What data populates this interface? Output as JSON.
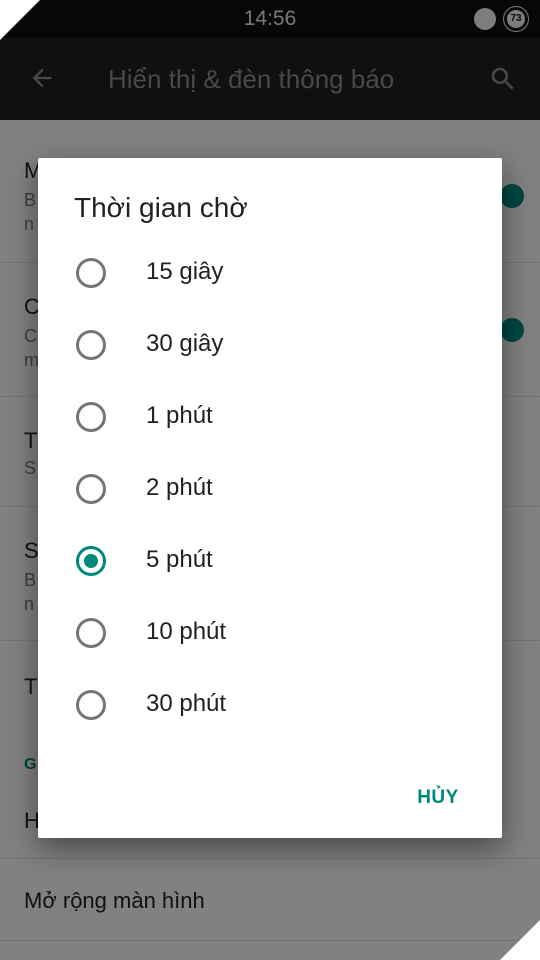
{
  "status_bar": {
    "time": "14:56",
    "battery": "73"
  },
  "app_bar": {
    "title": "Hiển thị & đèn thông báo"
  },
  "background_list": {
    "rows": [
      {
        "title": "M",
        "subtitle": "B",
        "subtitle2": "n"
      },
      {
        "title": "C",
        "subtitle": "C",
        "subtitle2": "m"
      },
      {
        "title": "T",
        "subtitle": "S"
      },
      {
        "title": "S",
        "subtitle": "B",
        "subtitle2": "n"
      },
      {
        "title": "T"
      }
    ],
    "section_label": "G",
    "row_h_title": "H",
    "row_expand_title": "Mở rộng màn hình"
  },
  "dialog": {
    "title": "Thời gian chờ",
    "options": [
      {
        "label": "15 giây",
        "checked": false
      },
      {
        "label": "30 giây",
        "checked": false
      },
      {
        "label": "1 phút",
        "checked": false
      },
      {
        "label": "2 phút",
        "checked": false
      },
      {
        "label": "5 phút",
        "checked": true
      },
      {
        "label": "10 phút",
        "checked": false
      },
      {
        "label": "30 phút",
        "checked": false
      }
    ],
    "cancel_label": "HỦY"
  },
  "colors": {
    "accent": "#00897b",
    "app_bar": "#1b2022",
    "status_bar": "#0d0f0f"
  }
}
